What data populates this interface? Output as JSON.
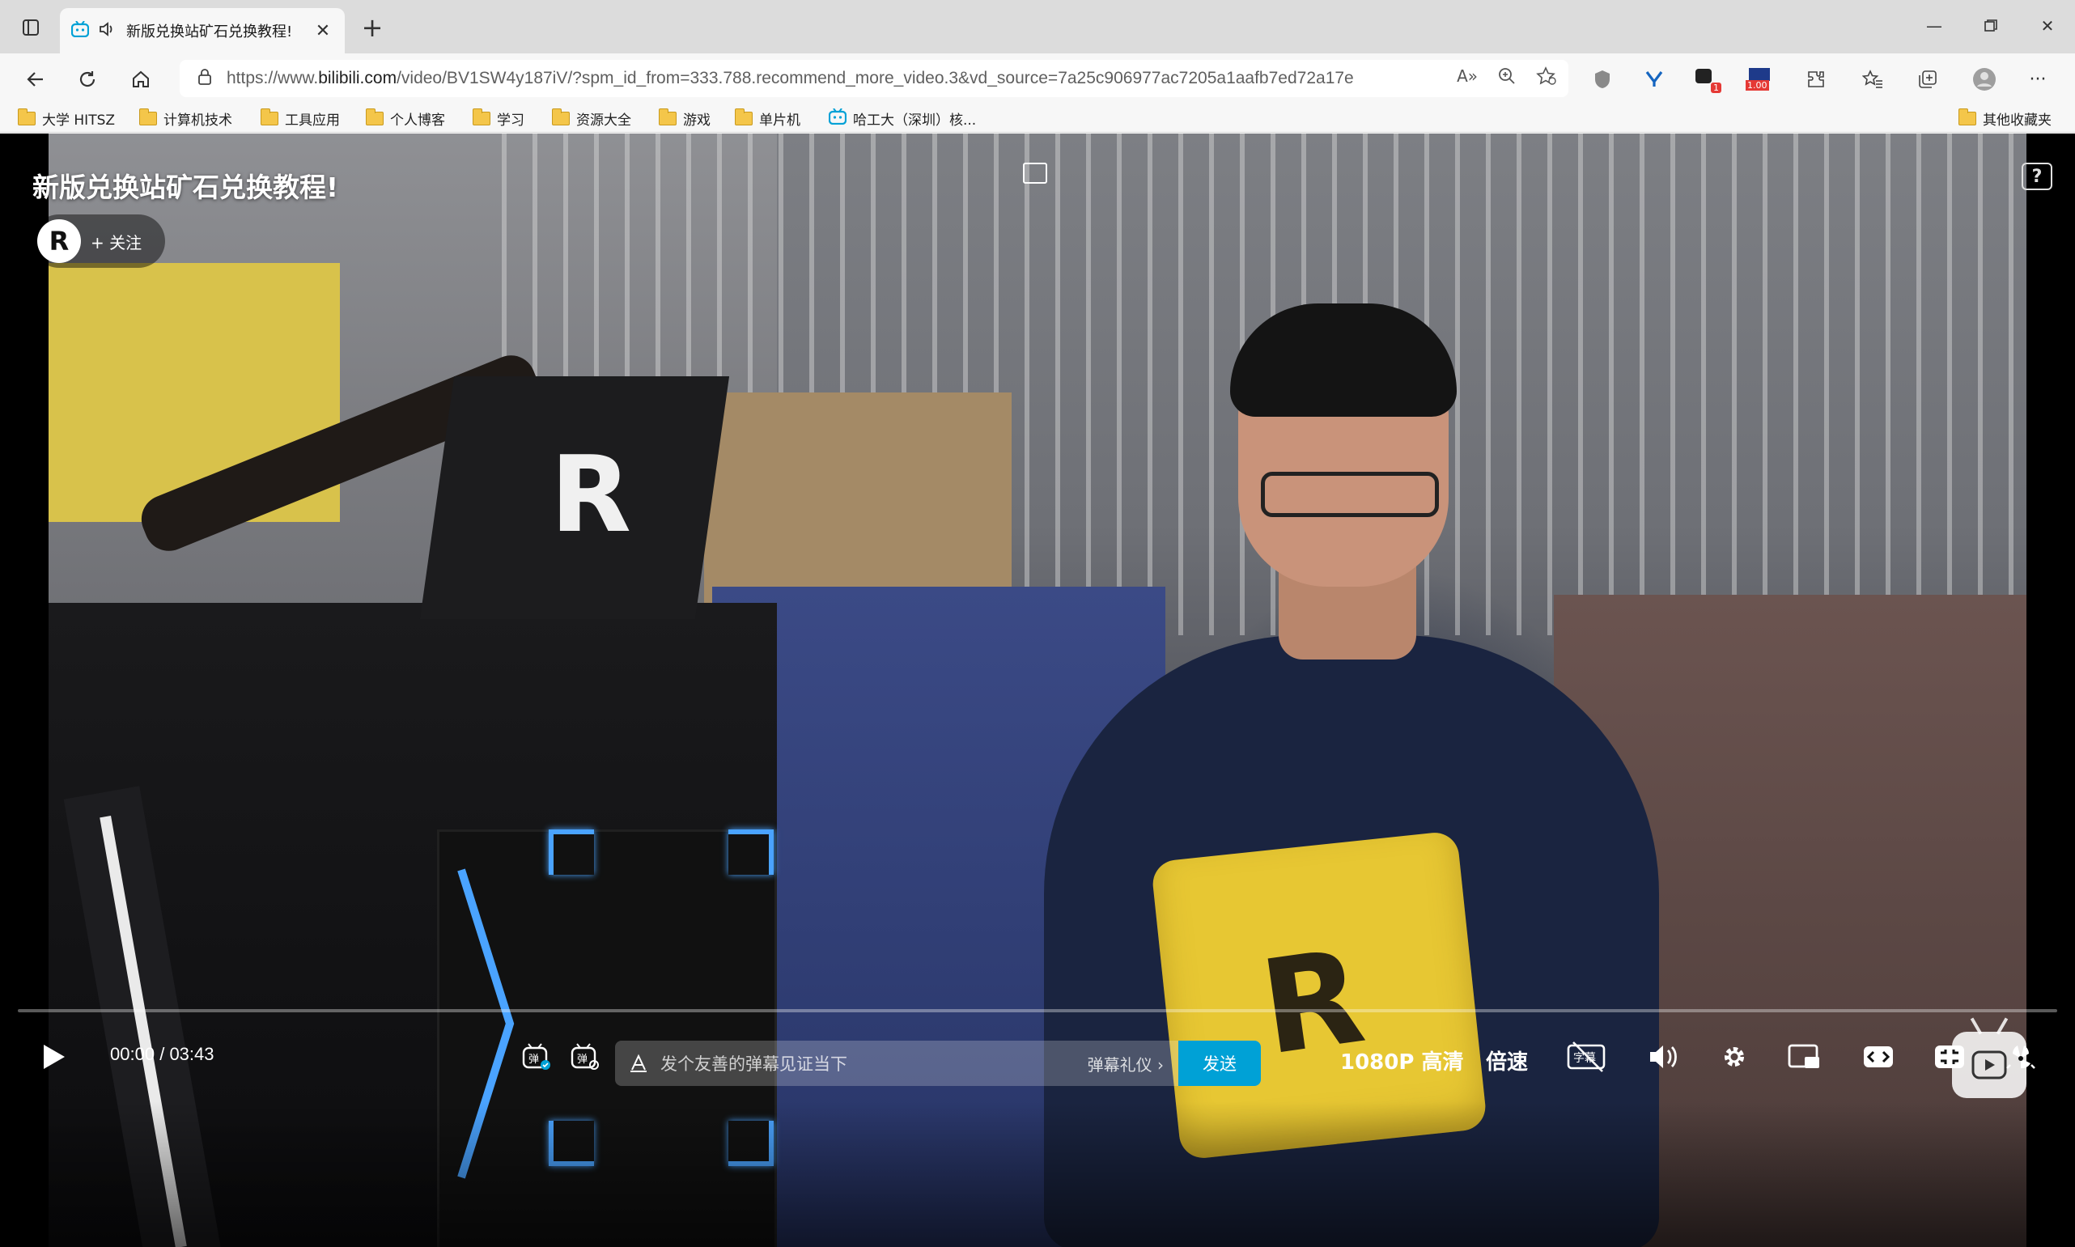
{
  "browser": {
    "tab": {
      "title": "新版兑换站矿石兑换教程!"
    },
    "address": {
      "url_prefix": "https://www.",
      "url_host": "bilibili.com",
      "url_path": "/video/BV1SW4y187iV/?spm_id_from=333.788.recommend_more_video.3&vd_source=7a25c906977ac7205a1aafb7ed72a17e"
    },
    "extensions": {
      "badge_1": "1",
      "badge_speed": "1.00"
    },
    "bookmarks": [
      {
        "label": "大学 HITSZ",
        "icon": "folder-icon"
      },
      {
        "label": "计算机技术",
        "icon": "folder-icon"
      },
      {
        "label": "工具应用",
        "icon": "folder-icon"
      },
      {
        "label": "个人博客",
        "icon": "folder-icon"
      },
      {
        "label": "学习",
        "icon": "folder-icon"
      },
      {
        "label": "资源大全",
        "icon": "folder-icon"
      },
      {
        "label": "游戏",
        "icon": "folder-icon"
      },
      {
        "label": "单片机",
        "icon": "folder-icon"
      },
      {
        "label": "哈工大（深圳）核...",
        "icon": "bilibili-icon"
      }
    ],
    "other_bookmarks": "其他收藏夹"
  },
  "player": {
    "title": "新版兑换站矿石兑换教程!",
    "uploader_avatar": "R",
    "follow_label": "+ 关注",
    "help_label": "?",
    "current_time": "00:00",
    "duration": "03:43",
    "time_separator": "/",
    "progress": 0.0,
    "danmaku_placeholder": "发个友善的弹幕见证当下",
    "gift_label": "弹幕礼仪 ›",
    "send_label": "发送",
    "quality_label": "1080P 高清",
    "speed_label": "倍速",
    "colors": {
      "accent": "#00a1d6"
    },
    "scene_logo": "R"
  }
}
